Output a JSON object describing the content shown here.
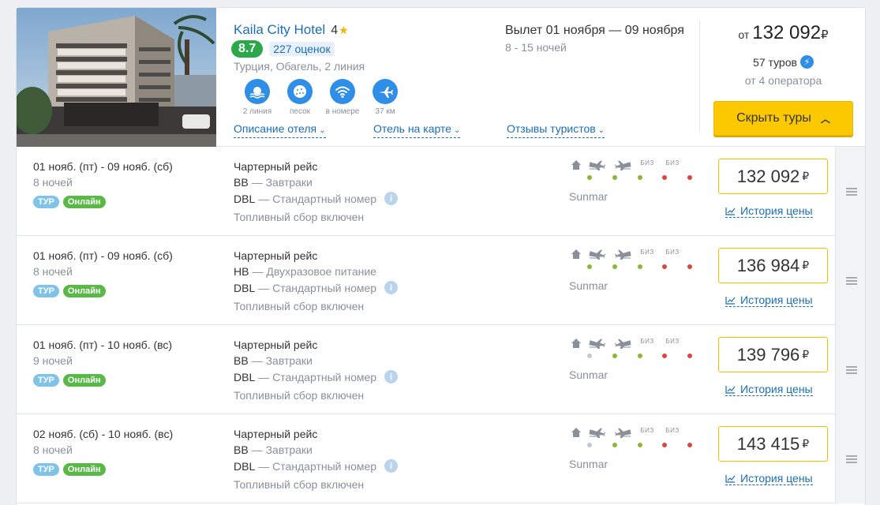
{
  "hotel": {
    "name": "Kaila City Hotel",
    "stars": "4",
    "rating": "8.7",
    "reviews": "227 оценок",
    "location": "Турция, Обагель, 2 линия",
    "features": [
      {
        "icon": "beach-icon",
        "label": "2 линия"
      },
      {
        "icon": "sand-icon",
        "label": "песок"
      },
      {
        "icon": "wifi-icon",
        "label": "в номере"
      },
      {
        "icon": "airport-icon",
        "label": "37 км"
      }
    ],
    "links": {
      "description": "Описание отеля",
      "map": "Отель на карте",
      "reviews": "Отзывы туристов"
    }
  },
  "flight": {
    "dates": "Вылет 01 ноября — 09 ноября",
    "nights": "8 - 15 ночей"
  },
  "price": {
    "from_label": "от",
    "amount": "132 092",
    "currency": "₽",
    "tours": "57 туров",
    "operators": "от 4 оператора",
    "hide_button": "Скрыть туры"
  },
  "service_labels": {
    "biz": "БИЗ"
  },
  "colors": {
    "green": "#8ab833",
    "red": "#d9473a",
    "gray": "#c4c8d0",
    "accent": "#fcc900",
    "link": "#1a6fb5"
  },
  "tours": [
    {
      "dates": "01 нояб. (пт) - 09 нояб. (сб)",
      "nights": "8 ночей",
      "badge_tour": "ТУР",
      "badge_online": "Онлайн",
      "flight": "Чартерный рейс",
      "meal_code": "BB",
      "meal": "— Завтраки",
      "room_code": "DBL",
      "room": "— Стандартный номер",
      "fuel": "Топливный сбор включен",
      "operator": "Sunmar",
      "price": "132 092",
      "currency": "₽",
      "history": "История цены",
      "status": [
        "green",
        "green",
        "green",
        "red",
        "red"
      ]
    },
    {
      "dates": "01 нояб. (пт) - 09 нояб. (сб)",
      "nights": "8 ночей",
      "badge_tour": "ТУР",
      "badge_online": "Онлайн",
      "flight": "Чартерный рейс",
      "meal_code": "HB",
      "meal": "— Двухразовое питание",
      "room_code": "DBL",
      "room": "— Стандартный номер",
      "fuel": "Топливный сбор включен",
      "operator": "Sunmar",
      "price": "136 984",
      "currency": "₽",
      "history": "История цены",
      "status": [
        "green",
        "green",
        "green",
        "red",
        "red"
      ]
    },
    {
      "dates": "01 нояб. (пт) - 10 нояб. (вс)",
      "nights": "9 ночей",
      "badge_tour": "ТУР",
      "badge_online": "Онлайн",
      "flight": "Чартерный рейс",
      "meal_code": "BB",
      "meal": "— Завтраки",
      "room_code": "DBL",
      "room": "— Стандартный номер",
      "fuel": "Топливный сбор включен",
      "operator": "Sunmar",
      "price": "139 796",
      "currency": "₽",
      "history": "История цены",
      "status": [
        "gray",
        "green",
        "green",
        "red",
        "red"
      ]
    },
    {
      "dates": "02 нояб. (сб) - 10 нояб. (вс)",
      "nights": "8 ночей",
      "badge_tour": "ТУР",
      "badge_online": "Онлайн",
      "flight": "Чартерный рейс",
      "meal_code": "BB",
      "meal": "— Завтраки",
      "room_code": "DBL",
      "room": "— Стандартный номер",
      "fuel": "Топливный сбор включен",
      "operator": "Sunmar",
      "price": "143 415",
      "currency": "₽",
      "history": "История цены",
      "status": [
        "gray",
        "green",
        "green",
        "red",
        "red"
      ]
    }
  ]
}
